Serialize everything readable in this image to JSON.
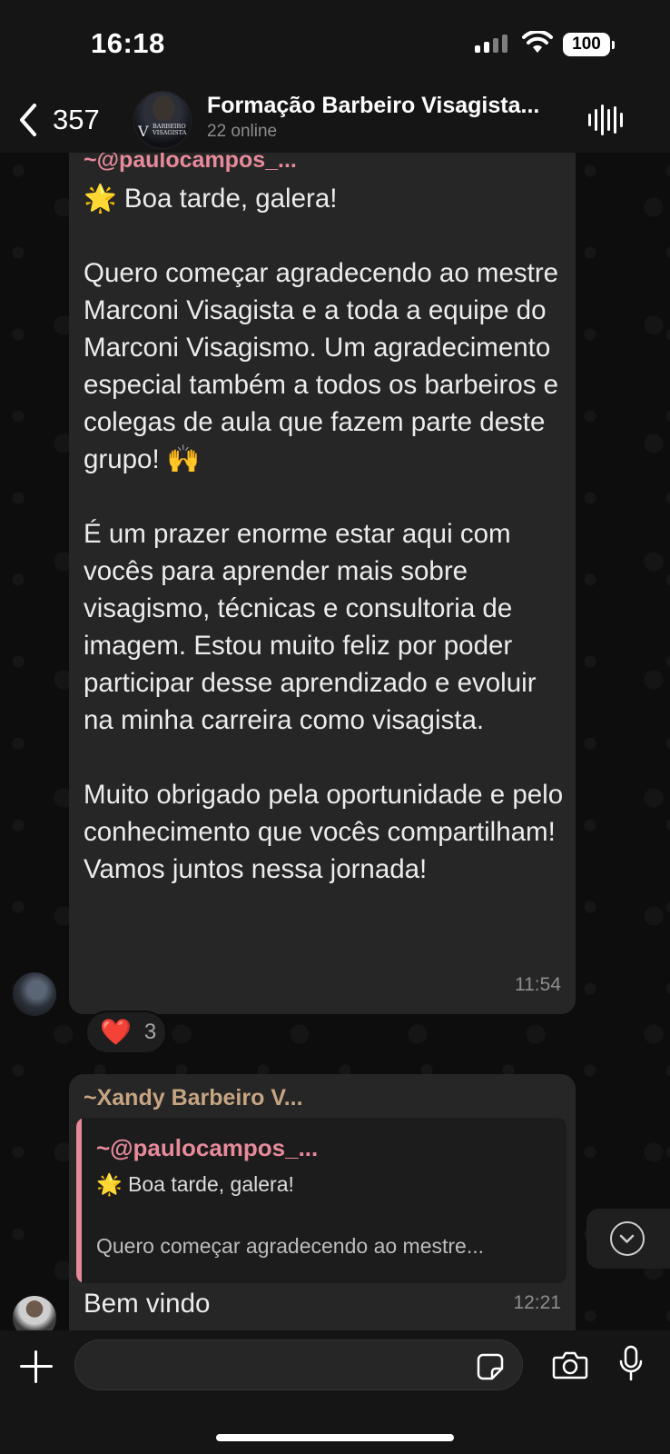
{
  "status_bar": {
    "time": "16:18",
    "battery": "100"
  },
  "header": {
    "back_count": "357",
    "title": "Formação Barbeiro Visagista...",
    "subtitle": "22 online",
    "avatar_text": "BARBEIRO VISAGISTA"
  },
  "messages": [
    {
      "sender": "~@paulocampos_...",
      "text": "🌟 Boa tarde, galera!\n\nQuero começar agradecendo ao mestre Marconi Visagista e a toda a equipe do Marconi Visagismo. Um agradecimento especial também a todos os barbeiros e colegas de aula que fazem parte deste grupo! 🙌\n\nÉ um prazer enorme estar aqui com vocês para aprender mais sobre visagismo, técnicas e consultoria de imagem. Estou muito feliz por poder participar desse aprendizado e evoluir na minha carreira como visagista.\n\nMuito obrigado pela oportunidade e pelo conhecimento que vocês compartilham! Vamos juntos nessa jornada!",
      "time": "11:54",
      "reaction": {
        "emoji": "❤️",
        "count": "3"
      }
    },
    {
      "sender": "~Xandy Barbeiro V...",
      "quote": {
        "sender": "~@paulocampos_...",
        "line1": "🌟 Boa tarde, galera!",
        "line2": "Quero começar agradecendo ao mestre..."
      },
      "text": "Bem vindo",
      "time": "12:21"
    }
  ],
  "colors": {
    "sender_pink": "#e78a9a",
    "sender_gold": "#c7a582",
    "bubble_bg": "#262626",
    "reaction_heart": "#e2251f"
  },
  "icons": [
    "back-chevron-icon",
    "voice-wave-icon",
    "plus-icon",
    "sticker-icon",
    "camera-icon",
    "microphone-icon",
    "chevron-down-circle-icon",
    "signal-icon",
    "wifi-icon"
  ]
}
